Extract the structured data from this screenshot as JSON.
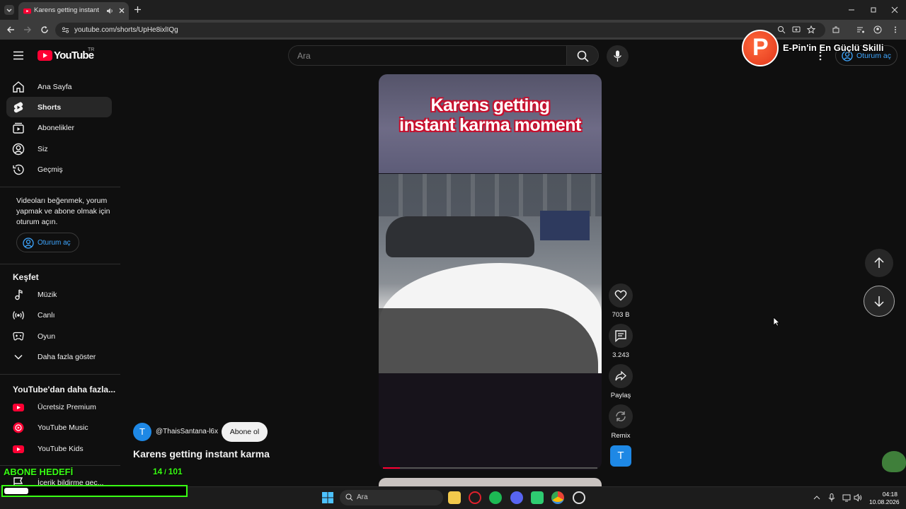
{
  "browser": {
    "tab_title": "Karens getting instant karma",
    "url": "youtube.com/shorts/UpHe8ixlIQg"
  },
  "header": {
    "logo": "YouTube",
    "region": "TR",
    "search_placeholder": "Ara",
    "login_label": "Oturum aç"
  },
  "sidebar": {
    "main": [
      {
        "label": "Ana Sayfa",
        "icon": "home-icon"
      },
      {
        "label": "Shorts",
        "icon": "shorts-icon"
      },
      {
        "label": "Abonelikler",
        "icon": "subscriptions-icon"
      },
      {
        "label": "Siz",
        "icon": "user-icon"
      },
      {
        "label": "Geçmiş",
        "icon": "history-icon"
      }
    ],
    "login_prompt": "Videoları beğenmek, yorum yapmak ve abone olmak için oturum açın.",
    "login_button": "Oturum aç",
    "explore_header": "Keşfet",
    "explore": [
      {
        "label": "Müzik",
        "icon": "music-icon"
      },
      {
        "label": "Canlı",
        "icon": "live-icon"
      },
      {
        "label": "Oyun",
        "icon": "gaming-icon"
      },
      {
        "label": "Daha fazla göster",
        "icon": "chevron-down-icon"
      }
    ],
    "more_header": "YouTube'dan daha fazla...",
    "more": [
      {
        "label": "Ücretsiz Premium",
        "icon": "youtube-premium-icon"
      },
      {
        "label": "YouTube Music",
        "icon": "youtube-music-icon"
      },
      {
        "label": "YouTube Kids",
        "icon": "youtube-kids-icon"
      },
      {
        "label": "İçerik bildirme geç...",
        "icon": "flag-icon"
      }
    ]
  },
  "short": {
    "overlay_line1": "Karens getting",
    "overlay_line2": "instant karma moment",
    "progress": 0.08,
    "channel_initial": "T",
    "channel": "@ThaisSantana-l6x",
    "subscribe": "Abone ol",
    "title": "Karens getting instant karma",
    "likes": "703 B",
    "comments": "3.243",
    "share": "Paylaş",
    "remix": "Remix",
    "avatar_initial": "T"
  },
  "stream": {
    "brand_initial": "P",
    "brand_text": "E-Pin'in En Güçlü Skilli",
    "goal_label": "ABONE HEDEFİ",
    "goal_current": "14",
    "goal_sep": " / ",
    "goal_target": "101",
    "goal_progress": 0.14
  },
  "taskbar": {
    "search": "Ara",
    "time": "04:18",
    "date": "10.08.2026"
  },
  "colors": {
    "accent_blue": "#3ea6ff",
    "brand_red": "#ff0033",
    "goal_green": "#39ff14"
  }
}
